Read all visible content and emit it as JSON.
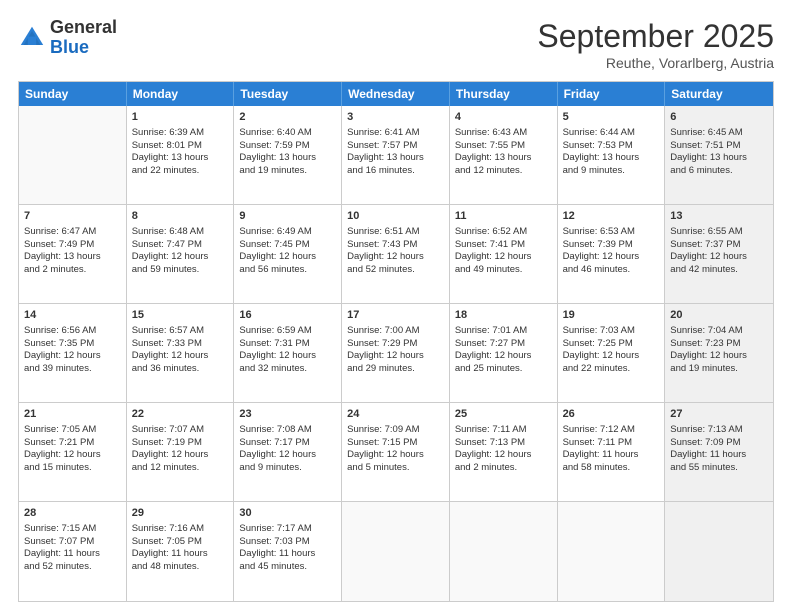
{
  "header": {
    "logo_general": "General",
    "logo_blue": "Blue",
    "month_title": "September 2025",
    "location": "Reuthe, Vorarlberg, Austria"
  },
  "weekdays": [
    "Sunday",
    "Monday",
    "Tuesday",
    "Wednesday",
    "Thursday",
    "Friday",
    "Saturday"
  ],
  "rows": [
    [
      {
        "day": "",
        "empty": true,
        "shaded": false,
        "lines": []
      },
      {
        "day": "1",
        "empty": false,
        "shaded": false,
        "lines": [
          "Sunrise: 6:39 AM",
          "Sunset: 8:01 PM",
          "Daylight: 13 hours",
          "and 22 minutes."
        ]
      },
      {
        "day": "2",
        "empty": false,
        "shaded": false,
        "lines": [
          "Sunrise: 6:40 AM",
          "Sunset: 7:59 PM",
          "Daylight: 13 hours",
          "and 19 minutes."
        ]
      },
      {
        "day": "3",
        "empty": false,
        "shaded": false,
        "lines": [
          "Sunrise: 6:41 AM",
          "Sunset: 7:57 PM",
          "Daylight: 13 hours",
          "and 16 minutes."
        ]
      },
      {
        "day": "4",
        "empty": false,
        "shaded": false,
        "lines": [
          "Sunrise: 6:43 AM",
          "Sunset: 7:55 PM",
          "Daylight: 13 hours",
          "and 12 minutes."
        ]
      },
      {
        "day": "5",
        "empty": false,
        "shaded": false,
        "lines": [
          "Sunrise: 6:44 AM",
          "Sunset: 7:53 PM",
          "Daylight: 13 hours",
          "and 9 minutes."
        ]
      },
      {
        "day": "6",
        "empty": false,
        "shaded": true,
        "lines": [
          "Sunrise: 6:45 AM",
          "Sunset: 7:51 PM",
          "Daylight: 13 hours",
          "and 6 minutes."
        ]
      }
    ],
    [
      {
        "day": "7",
        "empty": false,
        "shaded": false,
        "lines": [
          "Sunrise: 6:47 AM",
          "Sunset: 7:49 PM",
          "Daylight: 13 hours",
          "and 2 minutes."
        ]
      },
      {
        "day": "8",
        "empty": false,
        "shaded": false,
        "lines": [
          "Sunrise: 6:48 AM",
          "Sunset: 7:47 PM",
          "Daylight: 12 hours",
          "and 59 minutes."
        ]
      },
      {
        "day": "9",
        "empty": false,
        "shaded": false,
        "lines": [
          "Sunrise: 6:49 AM",
          "Sunset: 7:45 PM",
          "Daylight: 12 hours",
          "and 56 minutes."
        ]
      },
      {
        "day": "10",
        "empty": false,
        "shaded": false,
        "lines": [
          "Sunrise: 6:51 AM",
          "Sunset: 7:43 PM",
          "Daylight: 12 hours",
          "and 52 minutes."
        ]
      },
      {
        "day": "11",
        "empty": false,
        "shaded": false,
        "lines": [
          "Sunrise: 6:52 AM",
          "Sunset: 7:41 PM",
          "Daylight: 12 hours",
          "and 49 minutes."
        ]
      },
      {
        "day": "12",
        "empty": false,
        "shaded": false,
        "lines": [
          "Sunrise: 6:53 AM",
          "Sunset: 7:39 PM",
          "Daylight: 12 hours",
          "and 46 minutes."
        ]
      },
      {
        "day": "13",
        "empty": false,
        "shaded": true,
        "lines": [
          "Sunrise: 6:55 AM",
          "Sunset: 7:37 PM",
          "Daylight: 12 hours",
          "and 42 minutes."
        ]
      }
    ],
    [
      {
        "day": "14",
        "empty": false,
        "shaded": false,
        "lines": [
          "Sunrise: 6:56 AM",
          "Sunset: 7:35 PM",
          "Daylight: 12 hours",
          "and 39 minutes."
        ]
      },
      {
        "day": "15",
        "empty": false,
        "shaded": false,
        "lines": [
          "Sunrise: 6:57 AM",
          "Sunset: 7:33 PM",
          "Daylight: 12 hours",
          "and 36 minutes."
        ]
      },
      {
        "day": "16",
        "empty": false,
        "shaded": false,
        "lines": [
          "Sunrise: 6:59 AM",
          "Sunset: 7:31 PM",
          "Daylight: 12 hours",
          "and 32 minutes."
        ]
      },
      {
        "day": "17",
        "empty": false,
        "shaded": false,
        "lines": [
          "Sunrise: 7:00 AM",
          "Sunset: 7:29 PM",
          "Daylight: 12 hours",
          "and 29 minutes."
        ]
      },
      {
        "day": "18",
        "empty": false,
        "shaded": false,
        "lines": [
          "Sunrise: 7:01 AM",
          "Sunset: 7:27 PM",
          "Daylight: 12 hours",
          "and 25 minutes."
        ]
      },
      {
        "day": "19",
        "empty": false,
        "shaded": false,
        "lines": [
          "Sunrise: 7:03 AM",
          "Sunset: 7:25 PM",
          "Daylight: 12 hours",
          "and 22 minutes."
        ]
      },
      {
        "day": "20",
        "empty": false,
        "shaded": true,
        "lines": [
          "Sunrise: 7:04 AM",
          "Sunset: 7:23 PM",
          "Daylight: 12 hours",
          "and 19 minutes."
        ]
      }
    ],
    [
      {
        "day": "21",
        "empty": false,
        "shaded": false,
        "lines": [
          "Sunrise: 7:05 AM",
          "Sunset: 7:21 PM",
          "Daylight: 12 hours",
          "and 15 minutes."
        ]
      },
      {
        "day": "22",
        "empty": false,
        "shaded": false,
        "lines": [
          "Sunrise: 7:07 AM",
          "Sunset: 7:19 PM",
          "Daylight: 12 hours",
          "and 12 minutes."
        ]
      },
      {
        "day": "23",
        "empty": false,
        "shaded": false,
        "lines": [
          "Sunrise: 7:08 AM",
          "Sunset: 7:17 PM",
          "Daylight: 12 hours",
          "and 9 minutes."
        ]
      },
      {
        "day": "24",
        "empty": false,
        "shaded": false,
        "lines": [
          "Sunrise: 7:09 AM",
          "Sunset: 7:15 PM",
          "Daylight: 12 hours",
          "and 5 minutes."
        ]
      },
      {
        "day": "25",
        "empty": false,
        "shaded": false,
        "lines": [
          "Sunrise: 7:11 AM",
          "Sunset: 7:13 PM",
          "Daylight: 12 hours",
          "and 2 minutes."
        ]
      },
      {
        "day": "26",
        "empty": false,
        "shaded": false,
        "lines": [
          "Sunrise: 7:12 AM",
          "Sunset: 7:11 PM",
          "Daylight: 11 hours",
          "and 58 minutes."
        ]
      },
      {
        "day": "27",
        "empty": false,
        "shaded": true,
        "lines": [
          "Sunrise: 7:13 AM",
          "Sunset: 7:09 PM",
          "Daylight: 11 hours",
          "and 55 minutes."
        ]
      }
    ],
    [
      {
        "day": "28",
        "empty": false,
        "shaded": false,
        "lines": [
          "Sunrise: 7:15 AM",
          "Sunset: 7:07 PM",
          "Daylight: 11 hours",
          "and 52 minutes."
        ]
      },
      {
        "day": "29",
        "empty": false,
        "shaded": false,
        "lines": [
          "Sunrise: 7:16 AM",
          "Sunset: 7:05 PM",
          "Daylight: 11 hours",
          "and 48 minutes."
        ]
      },
      {
        "day": "30",
        "empty": false,
        "shaded": false,
        "lines": [
          "Sunrise: 7:17 AM",
          "Sunset: 7:03 PM",
          "Daylight: 11 hours",
          "and 45 minutes."
        ]
      },
      {
        "day": "",
        "empty": true,
        "shaded": false,
        "lines": []
      },
      {
        "day": "",
        "empty": true,
        "shaded": false,
        "lines": []
      },
      {
        "day": "",
        "empty": true,
        "shaded": false,
        "lines": []
      },
      {
        "day": "",
        "empty": true,
        "shaded": true,
        "lines": []
      }
    ]
  ]
}
